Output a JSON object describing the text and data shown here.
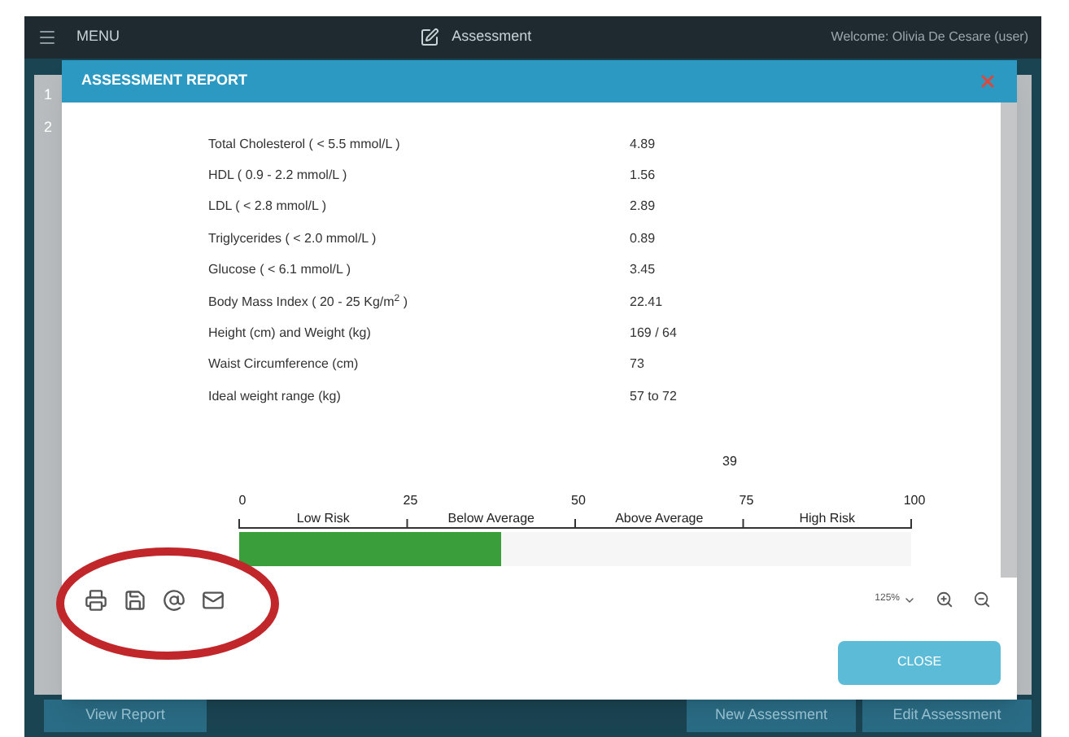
{
  "app": {
    "menu_label": "MENU",
    "title": "Assessment",
    "welcome": "Welcome: Olivia De Cesare (user)"
  },
  "background": {
    "row_numbers": [
      "1",
      "2"
    ],
    "buttons": [
      "View Report",
      "New Assessment",
      "Edit Assessment"
    ]
  },
  "modal": {
    "title": "ASSESSMENT REPORT",
    "results": [
      {
        "label": "Total Cholesterol ( < 5.5 mmol/L )",
        "value": "4.89"
      },
      {
        "label": "HDL  ( 0.9 - 2.2 mmol/L )",
        "value": "1.56"
      },
      {
        "label": "LDL ( < 2.8 mmol/L )",
        "value": "2.89"
      },
      {
        "label": "Triglycerides ( < 2.0 mmol/L )",
        "value": "0.89"
      },
      {
        "label": "Glucose  ( < 6.1 mmol/L )",
        "value": "3.45"
      },
      {
        "label": "Body Mass Index ( 20 - 25 Kg/m$^{2}$ )",
        "value": "22.41"
      },
      {
        "label": "Height (cm) and Weight (kg)",
        "value": "169  /  64"
      },
      {
        "label": "Waist Circumference (cm)",
        "value": "73"
      },
      {
        "label": "Ideal weight range (kg)",
        "value": "57  to  72"
      }
    ],
    "risk_gauge": {
      "value_label": "39",
      "segments": [
        "Low Risk",
        "Below Average",
        "Above Average",
        "High Risk"
      ],
      "scale_labels": [
        "0",
        "25",
        "50",
        "75",
        "100"
      ],
      "level": 0.39
    },
    "zoom_level": "125%",
    "close_button": "CLOSE"
  }
}
